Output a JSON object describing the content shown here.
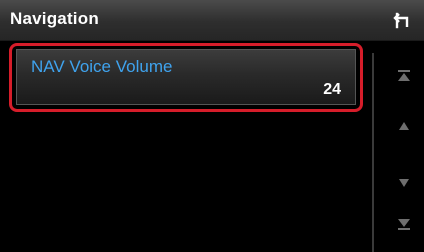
{
  "header": {
    "title": "Navigation",
    "back_icon": "return-arrow-icon"
  },
  "list": {
    "items": [
      {
        "label": "NAV Voice Volume",
        "value": "24",
        "highlighted": true
      }
    ]
  },
  "scrollbar": {
    "buttons": [
      {
        "icon": "scroll-to-top-icon"
      },
      {
        "icon": "scroll-up-icon"
      },
      {
        "icon": "scroll-down-icon"
      },
      {
        "icon": "scroll-to-bottom-icon"
      }
    ]
  },
  "colors": {
    "label_blue": "#3fa3ee",
    "highlight_red": "#d61d2a",
    "header_bg": "#3a3a3a",
    "scroll_icon": "#6e6e6e"
  }
}
